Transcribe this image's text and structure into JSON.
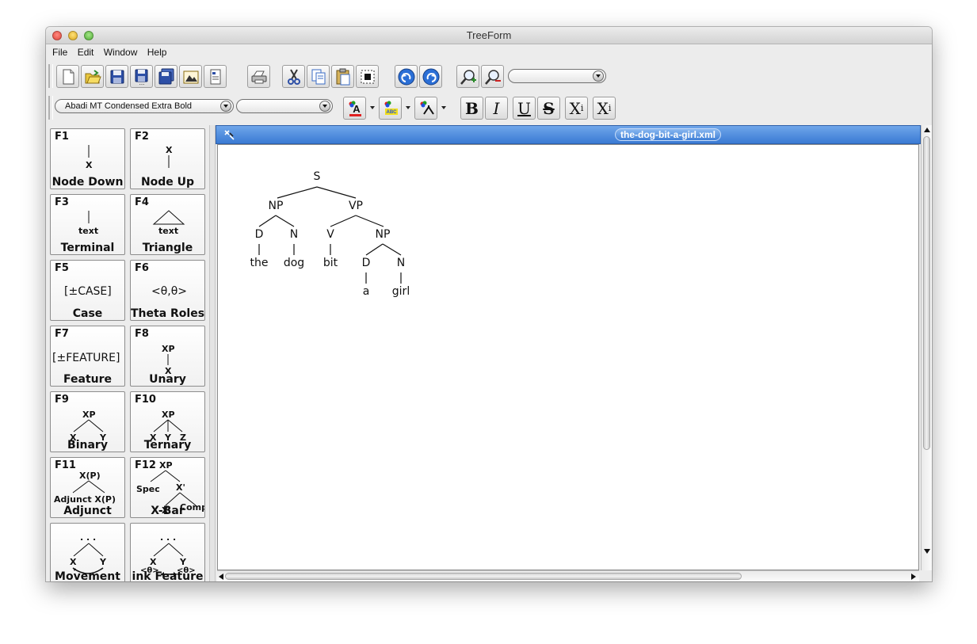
{
  "window": {
    "title": "TreeForm"
  },
  "menu": [
    "File",
    "Edit",
    "Window",
    "Help"
  ],
  "toolbar": {
    "buttons": [
      "new-file-icon",
      "open-folder-icon",
      "save-icon",
      "save-as-icon",
      "save-all-icon",
      "export-image-icon",
      "properties-icon",
      "print-icon",
      "cut-icon",
      "copy-icon",
      "paste-icon",
      "select-icon",
      "undo-icon",
      "redo-icon",
      "zoom-in-icon",
      "zoom-out-icon"
    ],
    "zoom_value": ""
  },
  "format_bar": {
    "font_family": "Abadi MT Condensed Extra Bold",
    "font_size": "",
    "bold_glyph": "B",
    "italic_glyph": "I",
    "underline_glyph": "U",
    "strike_glyph": "S",
    "subscript_glyph": "X",
    "subscript_mark": "i",
    "superscript_glyph": "X",
    "superscript_mark": "i",
    "font_color": "#e02020",
    "highlight_color": "#f4e01a"
  },
  "palette": [
    {
      "key": "F1",
      "label": "Node Down"
    },
    {
      "key": "F2",
      "label": "Node Up"
    },
    {
      "key": "F3",
      "label": "Terminal"
    },
    {
      "key": "F4",
      "label": "Triangle"
    },
    {
      "key": "F5",
      "label": "Case"
    },
    {
      "key": "F6",
      "label": "Theta Roles"
    },
    {
      "key": "F7",
      "label": "Feature"
    },
    {
      "key": "F8",
      "label": "Unary"
    },
    {
      "key": "F9",
      "label": "Binary"
    },
    {
      "key": "F10",
      "label": "Ternary"
    },
    {
      "key": "F11",
      "label": "Adjunct"
    },
    {
      "key": "F12",
      "label": "X-Bar"
    },
    {
      "key": "",
      "label": "Movement"
    },
    {
      "key": "",
      "label": "ink Feature"
    }
  ],
  "palette_glyphs": {
    "x": "X",
    "text": "text",
    "case": "[±CASE]",
    "theta": "<θ,θ>",
    "feature": "[±FEATURE]",
    "xp": "XP",
    "y": "Y",
    "z": "Z",
    "xp_paren": "X(P)",
    "adjunct": "Adjunct X(P)",
    "spec": "Spec",
    "xbar": "X'",
    "comp": "Comp",
    "dots": ". . .",
    "theta1": "<θ>",
    "theta2": "<θ>"
  },
  "document": {
    "filename": "the-dog-bit-a-girl.xml",
    "tree": {
      "S": "S",
      "NP1": "NP",
      "VP": "VP",
      "D1": "D",
      "N1": "N",
      "V": "V",
      "NP2": "NP",
      "the": "the",
      "dog": "dog",
      "bit": "bit",
      "D2": "D",
      "N2": "N",
      "a": "a",
      "girl": "girl"
    }
  }
}
